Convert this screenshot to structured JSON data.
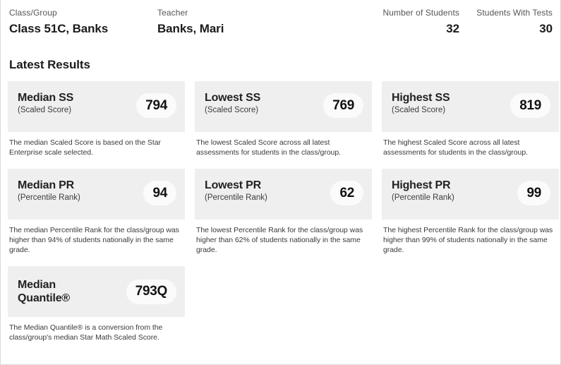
{
  "header": {
    "class_group_label": "Class/Group",
    "class_group_value": "Class 51C, Banks",
    "teacher_label": "Teacher",
    "teacher_value": "Banks, Mari",
    "number_of_students_label": "Number of Students",
    "number_of_students_value": "32",
    "students_with_tests_label": "Students With Tests",
    "students_with_tests_value": "30"
  },
  "section": {
    "title": "Latest Results"
  },
  "cards": [
    {
      "title": "Median SS",
      "subtitle": "(Scaled Score)",
      "value": "794",
      "description": "The median Scaled Score is based on the Star Enterprise scale selected."
    },
    {
      "title": "Lowest SS",
      "subtitle": "(Scaled Score)",
      "value": "769",
      "description": "The lowest Scaled Score across all latest assessments for students in the class/group."
    },
    {
      "title": "Highest SS",
      "subtitle": "(Scaled Score)",
      "value": "819",
      "description": "The highest Scaled Score across all latest assessments for students in the class/group."
    },
    {
      "title": "Median PR",
      "subtitle": "(Percentile Rank)",
      "value": "94",
      "description": "The median Percentile Rank for the class/group was higher than 94% of students nationally in the same grade."
    },
    {
      "title": "Lowest PR",
      "subtitle": "(Percentile Rank)",
      "value": "62",
      "description": "The lowest Percentile Rank for the class/group was higher than 62% of students nationally in the same grade."
    },
    {
      "title": "Highest PR",
      "subtitle": "(Percentile Rank)",
      "value": "99",
      "description": "The highest Percentile Rank for the class/group was higher than 99% of students nationally in the same grade."
    },
    {
      "title": "Median Quantile®",
      "subtitle": "",
      "value": "793Q",
      "description": "The Median Quantile® is a conversion from the class/group's median Star Math Scaled Score."
    }
  ],
  "colors": {
    "card_head_bg": "#efefef",
    "value_pill_bg": "#fbfbfb",
    "text_primary": "#1b1b1b",
    "text_secondary": "#555555",
    "page_bg": "#ffffff"
  }
}
